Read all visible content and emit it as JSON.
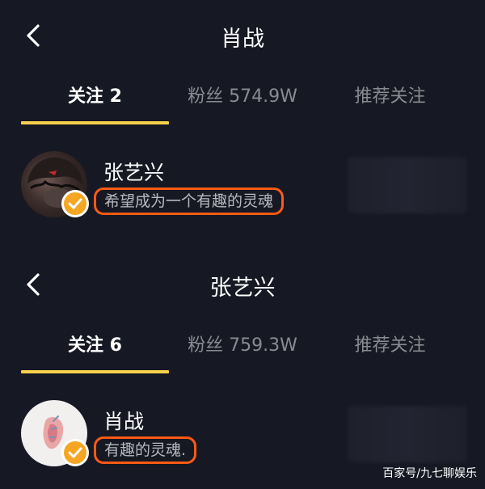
{
  "panel1": {
    "title": "肖战",
    "tabs": [
      {
        "label": "关注 2"
      },
      {
        "label": "粉丝 574.9W"
      },
      {
        "label": "推荐关注"
      }
    ],
    "user": {
      "name": "张艺兴",
      "bio": "希望成为一个有趣的灵魂",
      "verified": true
    }
  },
  "panel2": {
    "title": "张艺兴",
    "tabs": [
      {
        "label": "关注 6"
      },
      {
        "label": "粉丝 759.3W"
      },
      {
        "label": "推荐关注"
      }
    ],
    "user": {
      "name": "肖战",
      "bio": "有趣的灵魂.",
      "verified": true
    }
  },
  "watermark": "百家号/九七聊娱乐",
  "colors": {
    "background": "#161823",
    "tab_indicator": "#fbd04a",
    "highlight_border": "#ff5a14",
    "verified_badge": "#f5a623"
  }
}
